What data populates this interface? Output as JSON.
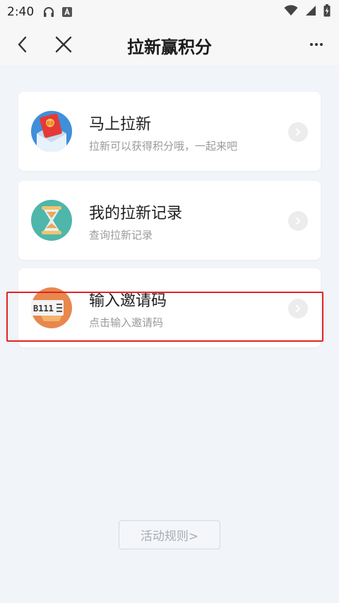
{
  "status_bar": {
    "time": "2:40"
  },
  "nav": {
    "title": "拉新赢积分"
  },
  "cards": [
    {
      "title": "马上拉新",
      "subtitle": "拉新可以获得积分哦，一起来吧",
      "icon": "red-envelope-icon"
    },
    {
      "title": "我的拉新记录",
      "subtitle": "查询拉新记录",
      "icon": "hourglass-icon"
    },
    {
      "title": "输入邀请码",
      "subtitle": "点击输入邀请码",
      "icon": "invite-code-icon",
      "icon_text": "B111"
    }
  ],
  "footer": {
    "rules_label": "活动规则>"
  },
  "colors": {
    "background": "#f1f4f8",
    "card": "#ffffff",
    "highlight": "#e02424",
    "subtitle": "#9a9a9a"
  }
}
